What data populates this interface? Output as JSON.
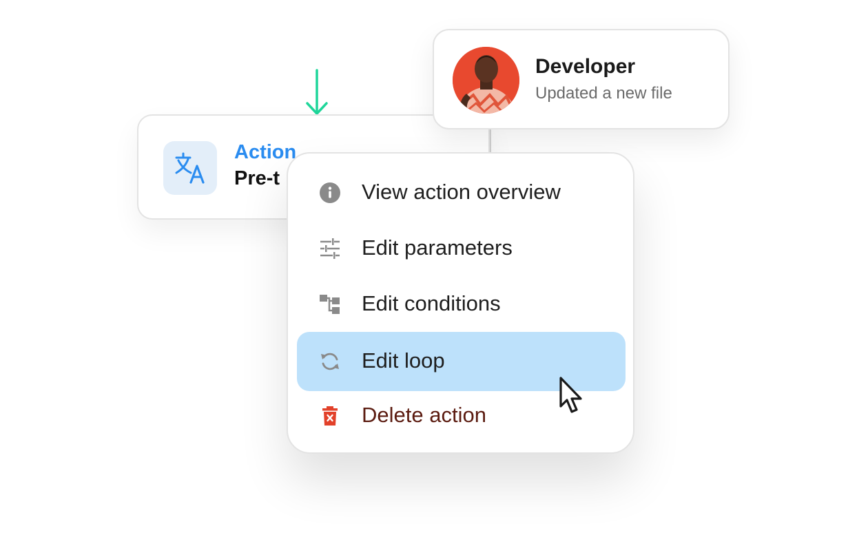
{
  "action_card": {
    "label": "Action",
    "name": "Pre-t",
    "icon": "translate-icon"
  },
  "developer_card": {
    "name": "Developer",
    "status": "Updated a new file",
    "avatar": "user-avatar"
  },
  "context_menu": {
    "items": [
      {
        "label": "View action overview",
        "icon": "info-icon"
      },
      {
        "label": "Edit parameters",
        "icon": "sliders-icon"
      },
      {
        "label": "Edit conditions",
        "icon": "branch-icon"
      },
      {
        "label": "Edit loop",
        "icon": "loop-icon",
        "hovered": true
      },
      {
        "label": "Delete action",
        "icon": "trash-icon",
        "danger": true
      }
    ]
  },
  "colors": {
    "accent_blue": "#2a8cf0",
    "hover_bg": "#bde1fb",
    "arrow_green": "#1fd69a",
    "danger_red": "#e2412a",
    "danger_text": "#5b1b10",
    "icon_gray": "#8a8a8a"
  }
}
